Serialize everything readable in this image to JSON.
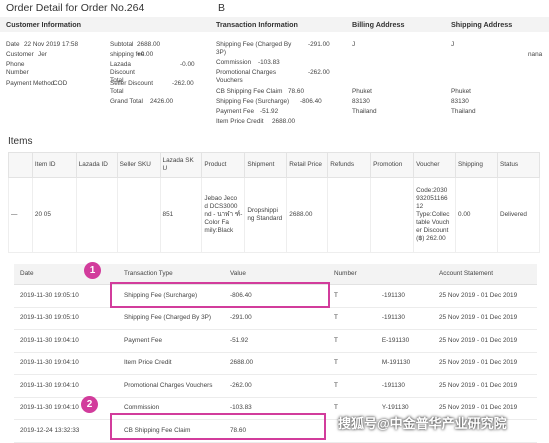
{
  "page": {
    "title": "Order Detail for Order No.264",
    "title_tail": "B"
  },
  "headers": {
    "customer": "Customer Information",
    "transaction": "Transaction Information",
    "billing": "Billing Address",
    "shipping": "Shipping Address"
  },
  "customer": {
    "date_label": "Date",
    "date_value": "22 Nov 2019 17:58",
    "customer_label": "Customer",
    "customer_value": "Jer",
    "phone_label": "Phone Number",
    "payment_label": "Payment Method",
    "payment_value": "COD"
  },
  "totals": {
    "subtotal_label": "Subtotal",
    "subtotal_value": "2688.00",
    "shipping_label": "shipping fee",
    "shipping_value": "+0.00",
    "lazada_label": "Lazada Discount Total",
    "lazada_value": "-0.00",
    "seller_label": "Seller Discount Total",
    "seller_value": "-262.00",
    "grand_label": "Grand Total",
    "grand_value": "2426.00"
  },
  "transaction": {
    "rows": [
      {
        "label": "Shipping Fee (Charged By 3P)",
        "value": "-291.00"
      },
      {
        "label": "Commission",
        "value": "-103.83"
      },
      {
        "label": "Promotional Charges Vouchers",
        "value": "-262.00"
      },
      {
        "label": "CB Shipping Fee Claim",
        "value": "78.60"
      },
      {
        "label": "Shipping Fee (Surcharge)",
        "value": "-806.40"
      },
      {
        "label": "Payment Fee",
        "value": "-51.92"
      },
      {
        "label": "Item Price Credit",
        "value": "2688.00"
      }
    ]
  },
  "billing": {
    "j": "J",
    "city": "Phuket",
    "zip": "83130",
    "country": "Thailand"
  },
  "shipping_addr": {
    "j": "J",
    "ana": "nana",
    "city": "Phuket",
    "zip": "83130",
    "country": "Thailand"
  },
  "items": {
    "title": "Items",
    "columns": [
      "Item ID",
      "Lazada ID",
      "Seller SKU",
      "Lazada SK U",
      "Product",
      "Shipment",
      "Retail Price",
      "Refunds",
      "Promotion",
      "Voucher",
      "Shipping",
      "Status"
    ],
    "row": {
      "dash": "—",
      "item_id": "20 05",
      "lazada_sku": "851",
      "product": "Jebao Jeco d DCS3000 nd - นาฬา ฑ์-Color Fa mily:Black",
      "shipment": "Dropshippi ng Standard",
      "retail_price": "2688.00",
      "voucher": "Code:2030 932051166 12 Type:Collec table Vouch er Discount (฿) 262.00",
      "shipping": "0.00",
      "status": "Delivered"
    }
  },
  "tx_table": {
    "columns": [
      "Date",
      "Transaction Type",
      "Value",
      "Number",
      "Account Statement"
    ],
    "rows": [
      {
        "date": "2019-11-30 19:05:10",
        "type": "Shipping Fee (Surcharge)",
        "value": "-806.40",
        "num_a": "T",
        "num_b": "-191130",
        "statement": "25 Nov 2019 - 01 Dec 2019"
      },
      {
        "date": "2019-11-30 19:05:10",
        "type": "Shipping Fee (Charged By 3P)",
        "value": "-291.00",
        "num_a": "T",
        "num_b": "-191130",
        "statement": "25 Nov 2019 - 01 Dec 2019"
      },
      {
        "date": "2019-11-30 19:04:10",
        "type": "Payment Fee",
        "value": "-51.92",
        "num_a": "T",
        "num_b": "E-191130",
        "statement": "25 Nov 2019 - 01 Dec 2019"
      },
      {
        "date": "2019-11-30 19:04:10",
        "type": "Item Price Credit",
        "value": "2688.00",
        "num_a": "T",
        "num_b": "M-191130",
        "statement": "25 Nov 2019 - 01 Dec 2019"
      },
      {
        "date": "2019-11-30 19:04:10",
        "type": "Promotional Charges Vouchers",
        "value": "-262.00",
        "num_a": "T",
        "num_b": "-191130",
        "statement": "25 Nov 2019 - 01 Dec 2019"
      },
      {
        "date": "2019-11-30 19:04:10",
        "type": "Commission",
        "value": "-103.83",
        "num_a": "T",
        "num_b": "Y-191130",
        "statement": "25 Nov 2019 - 01 Dec 2019"
      },
      {
        "date": "2019-12-24 13:32:33",
        "type": "CB Shipping Fee Claim",
        "value": "78.60",
        "num_a": "",
        "num_b": "",
        "statement": ""
      }
    ]
  },
  "annotations": {
    "badge1": "1",
    "badge2": "2"
  },
  "watermark": {
    "text": "搜狐号@中金普华产业研究院"
  },
  "colors": {
    "highlight": "#d23c9c",
    "header_bg": "#f3f3f3"
  }
}
